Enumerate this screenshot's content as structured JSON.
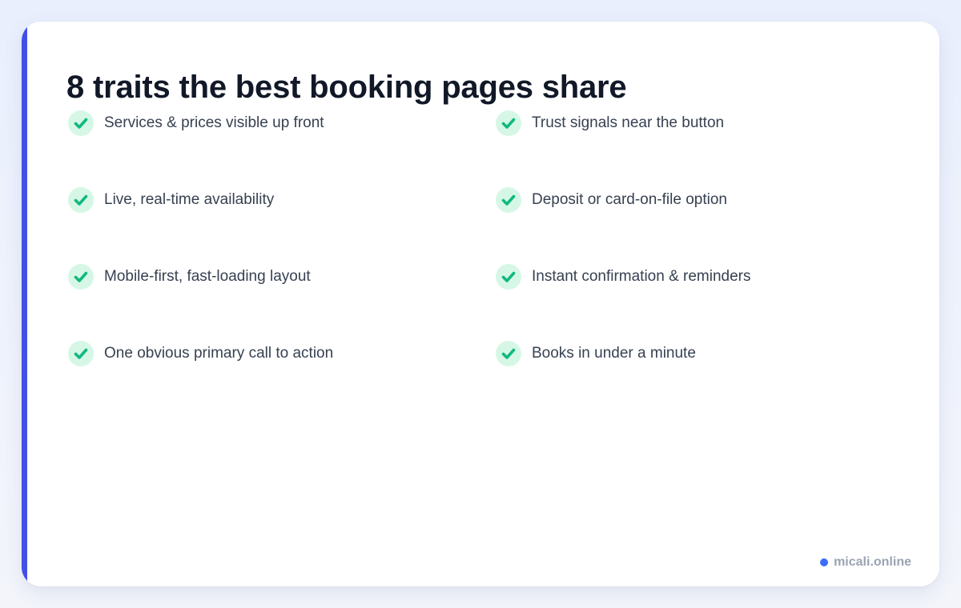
{
  "title": "8 traits the best booking pages share",
  "traits": [
    {
      "label": "Services & prices visible up front",
      "icon": "check-icon"
    },
    {
      "label": "Trust signals near the button",
      "icon": "check-icon"
    },
    {
      "label": "Live, real-time availability",
      "icon": "check-icon"
    },
    {
      "label": "Deposit or card-on-file option",
      "icon": "check-icon"
    },
    {
      "label": "Mobile-first, fast-loading layout",
      "icon": "check-icon"
    },
    {
      "label": "Instant confirmation & reminders",
      "icon": "check-icon"
    },
    {
      "label": "One obvious primary call to action",
      "icon": "check-icon"
    },
    {
      "label": "Books in under a minute",
      "icon": "check-icon"
    }
  ],
  "footer": {
    "brand": "micali.online"
  },
  "colors": {
    "accent": "#4250e6",
    "check": "#10b981",
    "check_bg": "#d6f7e6",
    "title": "#111827",
    "text": "#374151",
    "footer_dot": "#3b6ef6",
    "footer_text": "#9aa3b2"
  }
}
